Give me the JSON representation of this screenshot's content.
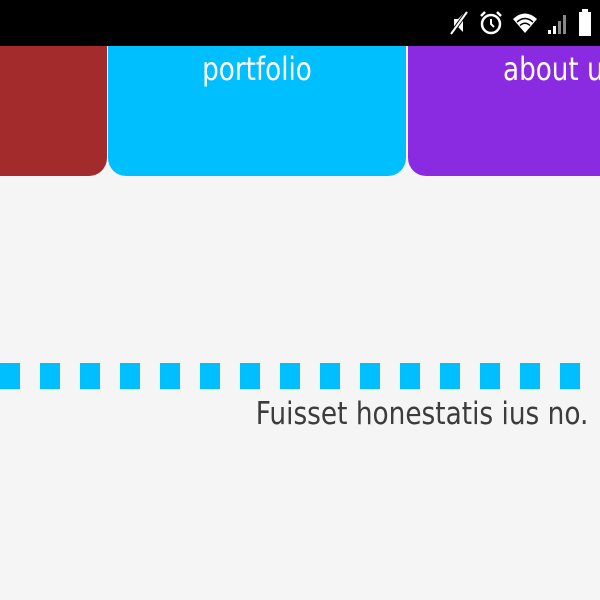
{
  "status_bar": {
    "icons": [
      "mute-icon",
      "alarm-icon",
      "wifi-icon",
      "signal-icon",
      "battery-icon"
    ]
  },
  "tabs": [
    {
      "label": "",
      "color": "#a32b2b"
    },
    {
      "label": "portfolio",
      "color": "#00bfff"
    },
    {
      "label": "about us",
      "color": "#8a2be2"
    }
  ],
  "divider": {
    "color": "#00bfff"
  },
  "content": {
    "text": "Fuisset honestatis ius no."
  }
}
